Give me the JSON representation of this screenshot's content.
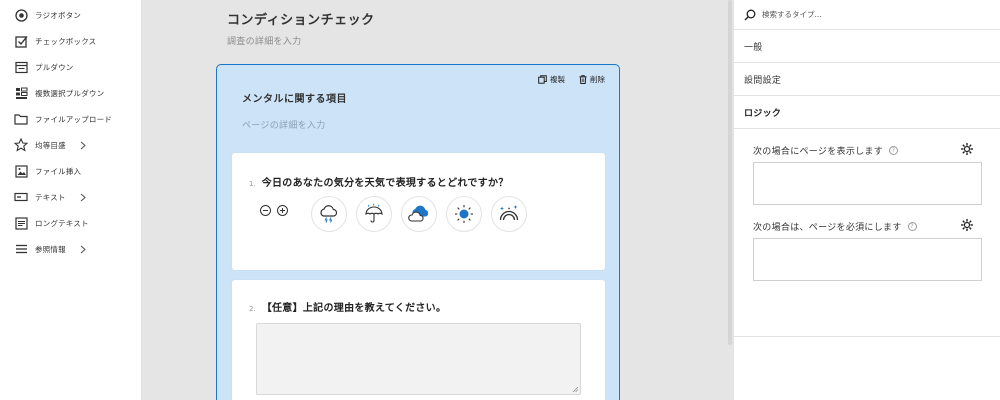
{
  "sidebar": {
    "items": [
      {
        "label": "ラジオボタン",
        "icon": "radio-icon",
        "has_chevron": false
      },
      {
        "label": "チェックボックス",
        "icon": "checkbox-icon",
        "has_chevron": false
      },
      {
        "label": "プルダウン",
        "icon": "dropdown-icon",
        "has_chevron": false
      },
      {
        "label": "複数選択プルダウン",
        "icon": "multi-dropdown-icon",
        "has_chevron": false
      },
      {
        "label": "ファイルアップロード",
        "icon": "folder-icon",
        "has_chevron": false
      },
      {
        "label": "均等目盛",
        "icon": "star-icon",
        "has_chevron": true
      },
      {
        "label": "ファイル挿入",
        "icon": "image-icon",
        "has_chevron": false
      },
      {
        "label": "テキスト",
        "icon": "text-field-icon",
        "has_chevron": true
      },
      {
        "label": "ロングテキスト",
        "icon": "long-text-icon",
        "has_chevron": false
      },
      {
        "label": "参照情報",
        "icon": "menu-icon",
        "has_chevron": true
      }
    ]
  },
  "survey": {
    "title": "コンディションチェック",
    "description_placeholder": "調査の詳細を入力"
  },
  "page_card": {
    "copy_label": "複製",
    "delete_label": "削除",
    "title": "メンタルに関する項目",
    "description_placeholder": "ページの詳細を入力"
  },
  "question1": {
    "number": "1.",
    "text": "今日のあなたの気分を天気で表現するとどれですか？",
    "options": [
      "thunderstorm-icon",
      "umbrella-rain-icon",
      "cloudy-icon",
      "sunny-icon",
      "rainbow-icon"
    ]
  },
  "question2": {
    "number": "2.",
    "text": "【任意】上記の理由を教えてください。"
  },
  "right_panel": {
    "search_placeholder": "検索するタイプ...",
    "tabs": {
      "general": "一般",
      "question_settings": "設問設定",
      "logic": "ロジック"
    },
    "conditions": {
      "show_label": "次の場合にページを表示します",
      "required_label": "次の場合は、ページを必須にします",
      "help_glyph": "?"
    }
  },
  "colors": {
    "accent": "#1f76c9",
    "card_bg": "#cde3f7",
    "canvas_bg": "#e6e5e5"
  }
}
